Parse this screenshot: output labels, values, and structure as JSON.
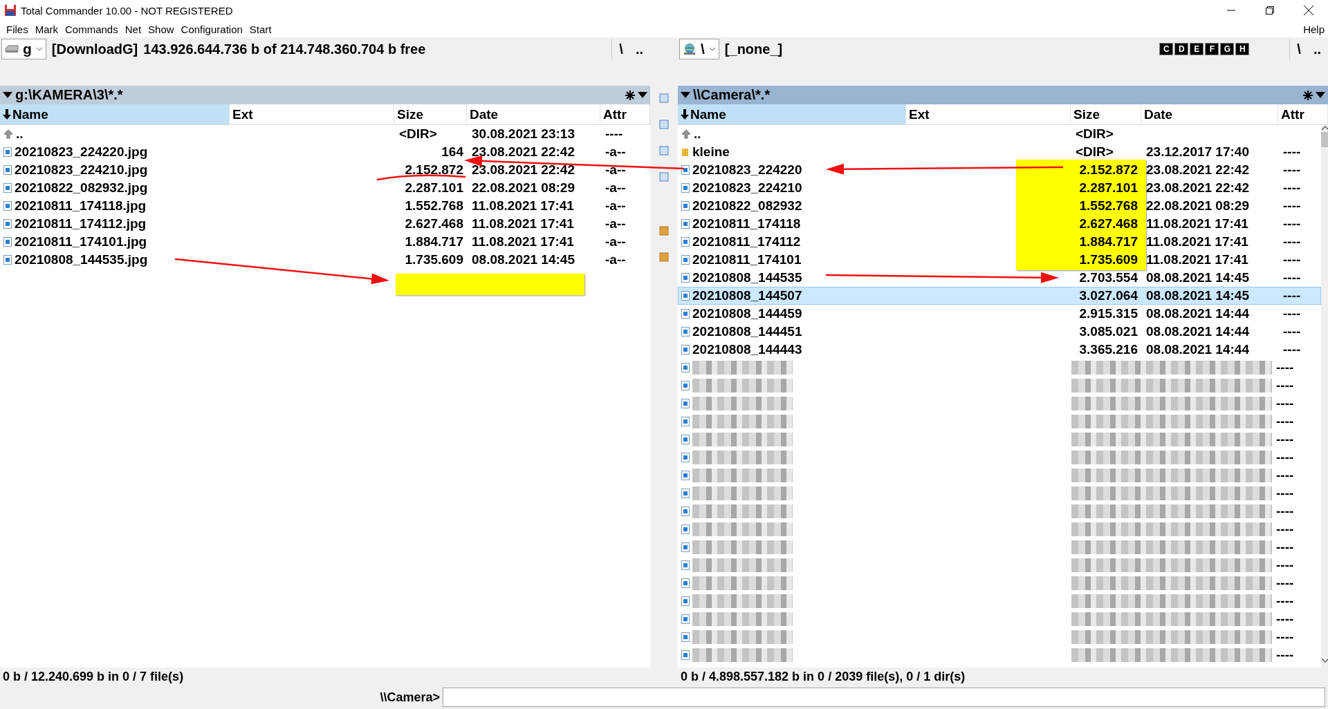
{
  "window": {
    "title": "Total Commander 10.00 - NOT REGISTERED"
  },
  "menu": [
    "Files",
    "Mark",
    "Commands",
    "Net",
    "Show",
    "Configuration",
    "Start"
  ],
  "help": "Help",
  "panels": [
    {
      "active": false,
      "drive": "g",
      "kind": "disk",
      "volume": "[DownloadG]",
      "free": "143.926.644.736 b of 214.748.360.704 b free",
      "root": "\\",
      "up": "..",
      "path": "g:\\KAMERA\\3\\*.*",
      "columns": [
        {
          "label": "Name",
          "sorted": true
        },
        {
          "label": "Ext",
          "sorted": false
        },
        {
          "label": "Size",
          "sorted": false
        },
        {
          "label": "Date",
          "sorted": false
        },
        {
          "label": "Attr",
          "sorted": false
        }
      ],
      "rows": [
        {
          "kind": "up",
          "name": "..",
          "size": "<DIR>",
          "date": "30.08.2021 23:13",
          "attr": "----",
          "selected": false
        },
        {
          "kind": "file",
          "name": "20210823_224220.jpg",
          "size": "164",
          "date": "23.08.2021 22:42",
          "attr": "-a--",
          "selected": false
        },
        {
          "kind": "file",
          "name": "20210823_224210.jpg",
          "size": "2.152.872",
          "date": "23.08.2021 22:42",
          "attr": "-a--",
          "selected": false
        },
        {
          "kind": "file",
          "name": "20210822_082932.jpg",
          "size": "2.287.101",
          "date": "22.08.2021 08:29",
          "attr": "-a--",
          "selected": false
        },
        {
          "kind": "file",
          "name": "20210811_174118.jpg",
          "size": "1.552.768",
          "date": "11.08.2021 17:41",
          "attr": "-a--",
          "selected": false
        },
        {
          "kind": "file",
          "name": "20210811_174112.jpg",
          "size": "2.627.468",
          "date": "11.08.2021 17:41",
          "attr": "-a--",
          "selected": false
        },
        {
          "kind": "file",
          "name": "20210811_174101.jpg",
          "size": "1.884.717",
          "date": "11.08.2021 17:41",
          "attr": "-a--",
          "selected": false
        },
        {
          "kind": "file",
          "name": "20210808_144535.jpg",
          "size": "1.735.609",
          "date": "08.08.2021 14:45",
          "attr": "-a--",
          "selected": false
        }
      ],
      "status": "0 b / 12.240.699 b in 0 / 7 file(s)"
    },
    {
      "active": true,
      "drive": "\\",
      "kind": "network",
      "volume": "[_none_]",
      "drive_buttons": [
        "C",
        "D",
        "E",
        "F",
        "G",
        "H"
      ],
      "root": "\\",
      "up": "..",
      "path": "\\\\Camera\\*.*",
      "columns": [
        {
          "label": "Name",
          "sorted": true
        },
        {
          "label": "Ext",
          "sorted": false
        },
        {
          "label": "Size",
          "sorted": false
        },
        {
          "label": "Date",
          "sorted": false
        },
        {
          "label": "Attr",
          "sorted": false
        }
      ],
      "rows": [
        {
          "kind": "up",
          "name": "..",
          "size": "<DIR>",
          "selected": false
        },
        {
          "kind": "folder",
          "name": "kleine",
          "size": "<DIR>",
          "date": "23.12.2017 17:40",
          "attr": "----",
          "selected": false
        },
        {
          "kind": "file",
          "name": "20210823_224220",
          "size": "2.152.872",
          "date": "23.08.2021 22:42",
          "attr": "----",
          "selected": false
        },
        {
          "kind": "file",
          "name": "20210823_224210",
          "size": "2.287.101",
          "date": "23.08.2021 22:42",
          "attr": "----",
          "selected": false
        },
        {
          "kind": "file",
          "name": "20210822_082932",
          "size": "1.552.768",
          "date": "22.08.2021 08:29",
          "attr": "----",
          "selected": false
        },
        {
          "kind": "file",
          "name": "20210811_174118",
          "size": "2.627.468",
          "date": "11.08.2021 17:41",
          "attr": "----",
          "selected": false
        },
        {
          "kind": "file",
          "name": "20210811_174112",
          "size": "1.884.717",
          "date": "11.08.2021 17:41",
          "attr": "----",
          "selected": false
        },
        {
          "kind": "file",
          "name": "20210811_174101",
          "size": "1.735.609",
          "date": "11.08.2021 17:41",
          "attr": "----",
          "selected": false
        },
        {
          "kind": "file",
          "name": "20210808_144535",
          "size": "2.703.554",
          "date": "08.08.2021 14:45",
          "attr": "----",
          "selected": false
        },
        {
          "kind": "file",
          "name": "20210808_144507",
          "size": "3.027.064",
          "date": "08.08.2021 14:45",
          "attr": "----",
          "selected": true
        },
        {
          "kind": "file",
          "name": "20210808_144459",
          "size": "2.915.315",
          "date": "08.08.2021 14:44",
          "attr": "----",
          "selected": false
        },
        {
          "kind": "file",
          "name": "20210808_144451",
          "size": "3.085.021",
          "date": "08.08.2021 14:44",
          "attr": "----",
          "selected": false
        },
        {
          "kind": "file",
          "name": "20210808_144443",
          "size": "3.365.216",
          "date": "08.08.2021 14:44",
          "attr": "----",
          "selected": false
        },
        {
          "kind": "blurred",
          "attr": "----",
          "selected": false
        },
        {
          "kind": "blurred",
          "attr": "----",
          "selected": false
        },
        {
          "kind": "blurred",
          "attr": "----",
          "selected": false
        },
        {
          "kind": "blurred",
          "attr": "----",
          "selected": false
        },
        {
          "kind": "blurred",
          "attr": "----",
          "selected": false
        },
        {
          "kind": "blurred",
          "attr": "----",
          "selected": false
        },
        {
          "kind": "blurred",
          "attr": "----",
          "selected": false
        },
        {
          "kind": "blurred",
          "attr": "----",
          "selected": false
        },
        {
          "kind": "blurred",
          "attr": "----",
          "selected": false
        },
        {
          "kind": "blurred",
          "attr": "----",
          "selected": false
        },
        {
          "kind": "blurred",
          "attr": "----",
          "selected": false
        },
        {
          "kind": "blurred",
          "attr": "----",
          "selected": false
        },
        {
          "kind": "blurred",
          "attr": "----",
          "selected": false
        },
        {
          "kind": "blurred",
          "attr": "----",
          "selected": false
        },
        {
          "kind": "blurred",
          "attr": "----",
          "selected": false
        },
        {
          "kind": "blurred",
          "attr": "----",
          "selected": false
        },
        {
          "kind": "blurred",
          "attr": "----",
          "selected": false
        }
      ],
      "status": "0 b / 4.898.557.182 b in 0 / 2039 file(s), 0 / 1 dir(s)"
    }
  ],
  "command_line": {
    "prompt": "\\\\Camera>"
  }
}
